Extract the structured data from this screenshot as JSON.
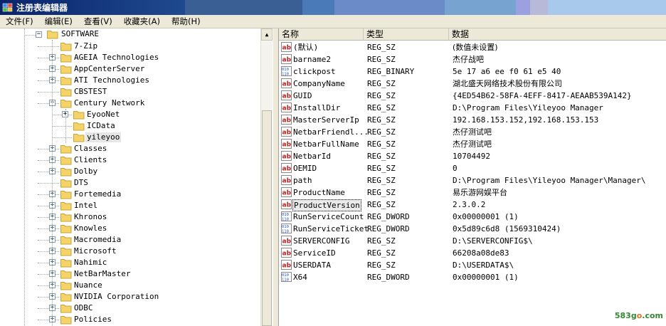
{
  "window": {
    "title": "注册表编辑器"
  },
  "menu": [
    "文件(F)",
    "编辑(E)",
    "查看(V)",
    "收藏夹(A)",
    "帮助(H)"
  ],
  "tree": {
    "root_label": "SOFTWARE",
    "items": [
      {
        "label": "7-Zip",
        "level": 1,
        "expander": "none"
      },
      {
        "label": "AGEIA Technologies",
        "level": 1,
        "expander": "+"
      },
      {
        "label": "AppCenterServer",
        "level": 1,
        "expander": "+"
      },
      {
        "label": "ATI Technologies",
        "level": 1,
        "expander": "+"
      },
      {
        "label": "CBSTEST",
        "level": 1,
        "expander": "none"
      },
      {
        "label": "Century Network",
        "level": 1,
        "expander": "-"
      },
      {
        "label": "EyooNet",
        "level": 2,
        "expander": "+"
      },
      {
        "label": "ICData",
        "level": 2,
        "expander": "none"
      },
      {
        "label": "yileyoo",
        "level": 2,
        "expander": "none",
        "selected": true
      },
      {
        "label": "Classes",
        "level": 1,
        "expander": "+"
      },
      {
        "label": "Clients",
        "level": 1,
        "expander": "+"
      },
      {
        "label": "Dolby",
        "level": 1,
        "expander": "+"
      },
      {
        "label": "DTS",
        "level": 1,
        "expander": "none"
      },
      {
        "label": "Fortemedia",
        "level": 1,
        "expander": "+"
      },
      {
        "label": "Intel",
        "level": 1,
        "expander": "+"
      },
      {
        "label": "Khronos",
        "level": 1,
        "expander": "+"
      },
      {
        "label": "Knowles",
        "level": 1,
        "expander": "+"
      },
      {
        "label": "Macromedia",
        "level": 1,
        "expander": "+"
      },
      {
        "label": "Microsoft",
        "level": 1,
        "expander": "+"
      },
      {
        "label": "Nahimic",
        "level": 1,
        "expander": "+"
      },
      {
        "label": "NetBarMaster",
        "level": 1,
        "expander": "+"
      },
      {
        "label": "Nuance",
        "level": 1,
        "expander": "+"
      },
      {
        "label": "NVIDIA Corporation",
        "level": 1,
        "expander": "+"
      },
      {
        "label": "ODBC",
        "level": 1,
        "expander": "+"
      },
      {
        "label": "Policies",
        "level": 1,
        "expander": "+"
      }
    ]
  },
  "list": {
    "headers": {
      "name": "名称",
      "type": "类型",
      "data": "数据"
    },
    "rows": [
      {
        "icon": "ab",
        "name": "(默认)",
        "type": "REG_SZ",
        "data": "(数值未设置)"
      },
      {
        "icon": "ab",
        "name": "barname2",
        "type": "REG_SZ",
        "data": "杰仔战吧"
      },
      {
        "icon": "bin",
        "name": "clickpost",
        "type": "REG_BINARY",
        "data": "5e 17 a6 ee f0 61 e5 40"
      },
      {
        "icon": "ab",
        "name": "CompanyName",
        "type": "REG_SZ",
        "data": "湖北盛天网络技术股份有限公司"
      },
      {
        "icon": "ab",
        "name": "GUID",
        "type": "REG_SZ",
        "data": "{4ED54B62-58FA-4EFF-8417-AEAAB539A142}"
      },
      {
        "icon": "ab",
        "name": "InstallDir",
        "type": "REG_SZ",
        "data": "D:\\Program Files\\Yileyoo Manager"
      },
      {
        "icon": "ab",
        "name": "MasterServerIp",
        "type": "REG_SZ",
        "data": "192.168.153.152,192.168.153.153"
      },
      {
        "icon": "ab",
        "name": "NetbarFriendl...",
        "type": "REG_SZ",
        "data": "杰仔测试吧"
      },
      {
        "icon": "ab",
        "name": "NetbarFullName",
        "type": "REG_SZ",
        "data": "杰仔测试吧"
      },
      {
        "icon": "ab",
        "name": "NetbarId",
        "type": "REG_SZ",
        "data": "10704492"
      },
      {
        "icon": "ab",
        "name": "OEMID",
        "type": "REG_SZ",
        "data": "0"
      },
      {
        "icon": "ab",
        "name": "path",
        "type": "REG_SZ",
        "data": "D:\\Program Files\\Yileyoo Manager\\Manager\\"
      },
      {
        "icon": "ab",
        "name": "ProductName",
        "type": "REG_SZ",
        "data": "易乐游网娱平台"
      },
      {
        "icon": "ab",
        "name": "ProductVersion",
        "type": "REG_SZ",
        "data": "2.3.0.2",
        "selected": true
      },
      {
        "icon": "bin",
        "name": "RunServiceCount",
        "type": "REG_DWORD",
        "data": "0x00000001 (1)"
      },
      {
        "icon": "bin",
        "name": "RunServiceTicket",
        "type": "REG_DWORD",
        "data": "0x5d89c6d8 (1569310424)"
      },
      {
        "icon": "ab",
        "name": "SERVERCONFIG",
        "type": "REG_SZ",
        "data": "D:\\SERVERCONFIG$\\"
      },
      {
        "icon": "ab",
        "name": "ServiceID",
        "type": "REG_SZ",
        "data": "66208a08de83"
      },
      {
        "icon": "ab",
        "name": "USERDATA",
        "type": "REG_SZ",
        "data": "D:\\USERDATA$\\"
      },
      {
        "icon": "bin",
        "name": "X64",
        "type": "REG_DWORD",
        "data": "0x00000001 (1)"
      }
    ]
  },
  "watermark": {
    "part1": "583g",
    "part2": "o",
    "part3": ".com"
  },
  "colors": {
    "accent_blue": "#0a246a",
    "folder_yellow": "#f5d36b",
    "watermark_green": "#2f8a2f"
  }
}
